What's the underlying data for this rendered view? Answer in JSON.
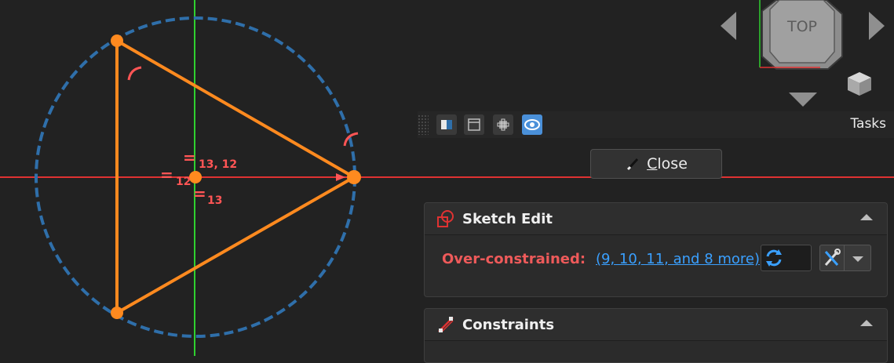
{
  "viewport": {
    "nav_cube": {
      "face_label": "TOP"
    },
    "constraint_labels": {
      "center_top": "13, 12",
      "center_left": "12",
      "center_bottom": "13",
      "equal_symbol": "="
    },
    "colors": {
      "geometry": "#ff8a1f",
      "circle": "#2f6faa",
      "x_axis": "#e03232",
      "y_axis": "#2fd02f",
      "constraint_text": "#ff5555"
    }
  },
  "task_panel": {
    "tasks_label": "Tasks",
    "tab_icons": [
      "model-icon",
      "report-view-icon",
      "part-icon",
      "tasks-eye-icon"
    ],
    "close_button": {
      "prefix": "",
      "underline": "C",
      "rest": "lose"
    },
    "sketch_edit": {
      "title": "Sketch Edit",
      "status_label": "Over-constrained:",
      "status_link": "(9, 10, 11, and 8 more)"
    },
    "constraints": {
      "title": "Constraints"
    }
  }
}
